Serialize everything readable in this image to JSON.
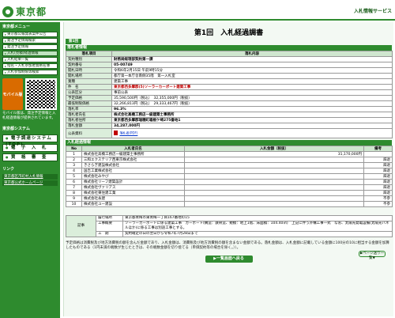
{
  "header": {
    "logo_text": "東京都",
    "service_name": "入札情報サービス"
  },
  "sidebar": {
    "menu_heading": "東京都メニュー",
    "items": [
      {
        "label": "東京都公報発表案件公告"
      },
      {
        "label": "発注予定情報検索"
      },
      {
        "label": "発注予定情報"
      },
      {
        "label": "入札(見積)経過情報"
      },
      {
        "label": "入札結果一覧"
      },
      {
        "label": "指名・入札参加者資格名簿"
      },
      {
        "label": "入札参加制限等検索"
      }
    ],
    "mobile_label": "モバイル版",
    "mobile_note": "モバイル版は、発注予定情報と入札経過情報が提供されています。",
    "system_heading": "東京都システム",
    "buttons": [
      {
        "label": "電子調達システム(TOP)"
      },
      {
        "label": "電　子　入　札"
      },
      {
        "label": "資　格　審　査"
      }
    ],
    "links_heading": "リンク",
    "links": [
      {
        "label": "東京都区市町村入札情報"
      },
      {
        "label": "東京都公式ホームページ"
      }
    ]
  },
  "main": {
    "page_title": "第1回　入札経過調書",
    "round_badge": "第1回",
    "info_section_label": "落札者情報",
    "info_headers": {
      "item": "落札項目",
      "content": "落札内容"
    },
    "info_rows": [
      {
        "label": "契約種別",
        "value": "財務局経理部契約第一課"
      },
      {
        "label": "契約番号",
        "value": "05-00749"
      },
      {
        "label": "開札日時",
        "value": "令和6年2月15日 午前9時15分"
      },
      {
        "label": "開札場所",
        "value": "都庁第一本庁舎南側35階　第一入札室"
      },
      {
        "label": "業種",
        "value": "建築工事"
      },
      {
        "label": "件　名",
        "value": "東京都西多摩郡(5)ソーラーカーポート建築工事"
      },
      {
        "label": "公表区分",
        "value": "事前公表"
      },
      {
        "label": "予定価格",
        "value": "35,590,500円（税込）　32,355,000円（税抜）"
      },
      {
        "label": "最低制限価格",
        "value": "32,266,813円（税込）　29,333,467円（税抜）"
      },
      {
        "label": "落札率",
        "value": "96.3%"
      },
      {
        "label": "落札者氏名",
        "value": "株式会社高橋工務店一級建築士事務所"
      },
      {
        "label": "落札者住所",
        "value": "東京都西多摩郡瑞穂町箱根ケ崎275番地1"
      },
      {
        "label": "落札金額",
        "value": "34,287,000円"
      },
      {
        "label": "公表資料",
        "value": ""
      }
    ],
    "pdf_link_label": "落札者(PDF)",
    "result_section_label": "入札経過情報",
    "result_headers": {
      "no": "No",
      "name": "入札者氏名",
      "amount": "入札金額（税抜）",
      "remark": "備考"
    },
    "result_rows": [
      {
        "no": "1",
        "name": "株式会社高橋工務店一級建築士事務所",
        "amount": "31,170,000円",
        "remark": ""
      },
      {
        "no": "2",
        "name": "三和エクステリア西東京株式会社",
        "amount": "",
        "remark": "辞退"
      },
      {
        "no": "3",
        "name": "きさらぎ建設株式会社",
        "amount": "",
        "remark": "辞退"
      },
      {
        "no": "4",
        "name": "国吉工業株式会社",
        "amount": "",
        "remark": "辞退"
      },
      {
        "no": "5",
        "name": "株式会社みやび",
        "amount": "",
        "remark": "辞退"
      },
      {
        "no": "6",
        "name": "株式会社リーフ建築設計",
        "amount": "",
        "remark": "辞退"
      },
      {
        "no": "7",
        "name": "株式会社ヴァリアス",
        "amount": "",
        "remark": "辞退"
      },
      {
        "no": "8",
        "name": "株式会社東住建工業",
        "amount": "",
        "remark": "辞退"
      },
      {
        "no": "9",
        "name": "株式会社永建",
        "amount": "",
        "remark": "不参"
      },
      {
        "no": "10",
        "name": "株式会社ユー建設",
        "amount": "",
        "remark": "不参"
      }
    ],
    "more_button_label": "▶ページ送り一覧▼",
    "remarks_key": "記事",
    "remarks_rows": [
      {
        "sub": "履行場所",
        "value": "東京都青梅市東青梅一丁目167番地の15"
      },
      {
        "sub": "工事概要",
        "value": "ソーラーカーポートに係る建築工事　カーポート(構造：鉄骨造、規模：地上1階、床面積：104.40㎡)　上記に伴う外構工事一式　なお、太陽光発電設備(太陽光パネルほか)に係る工事は別途工事とする。"
      },
      {
        "sub": "工　期",
        "value": "契約確定の日の翌日から令和7年7月28日まで"
      }
    ],
    "footnote": "予定価格は消費税及び地方消費税の額を含んだ金額であり、入札金額は、消費税及び地方消費税の額を含まない金額である。落札金額は、入札金額に記載している金額に100分の10に相当する金額を加算したものである（1円未満の端数が生じたときは、その端数金額を切り捨てる（単価契約等の場合を除く。））。",
    "back_button_label": "▶一覧画面へ戻る"
  }
}
